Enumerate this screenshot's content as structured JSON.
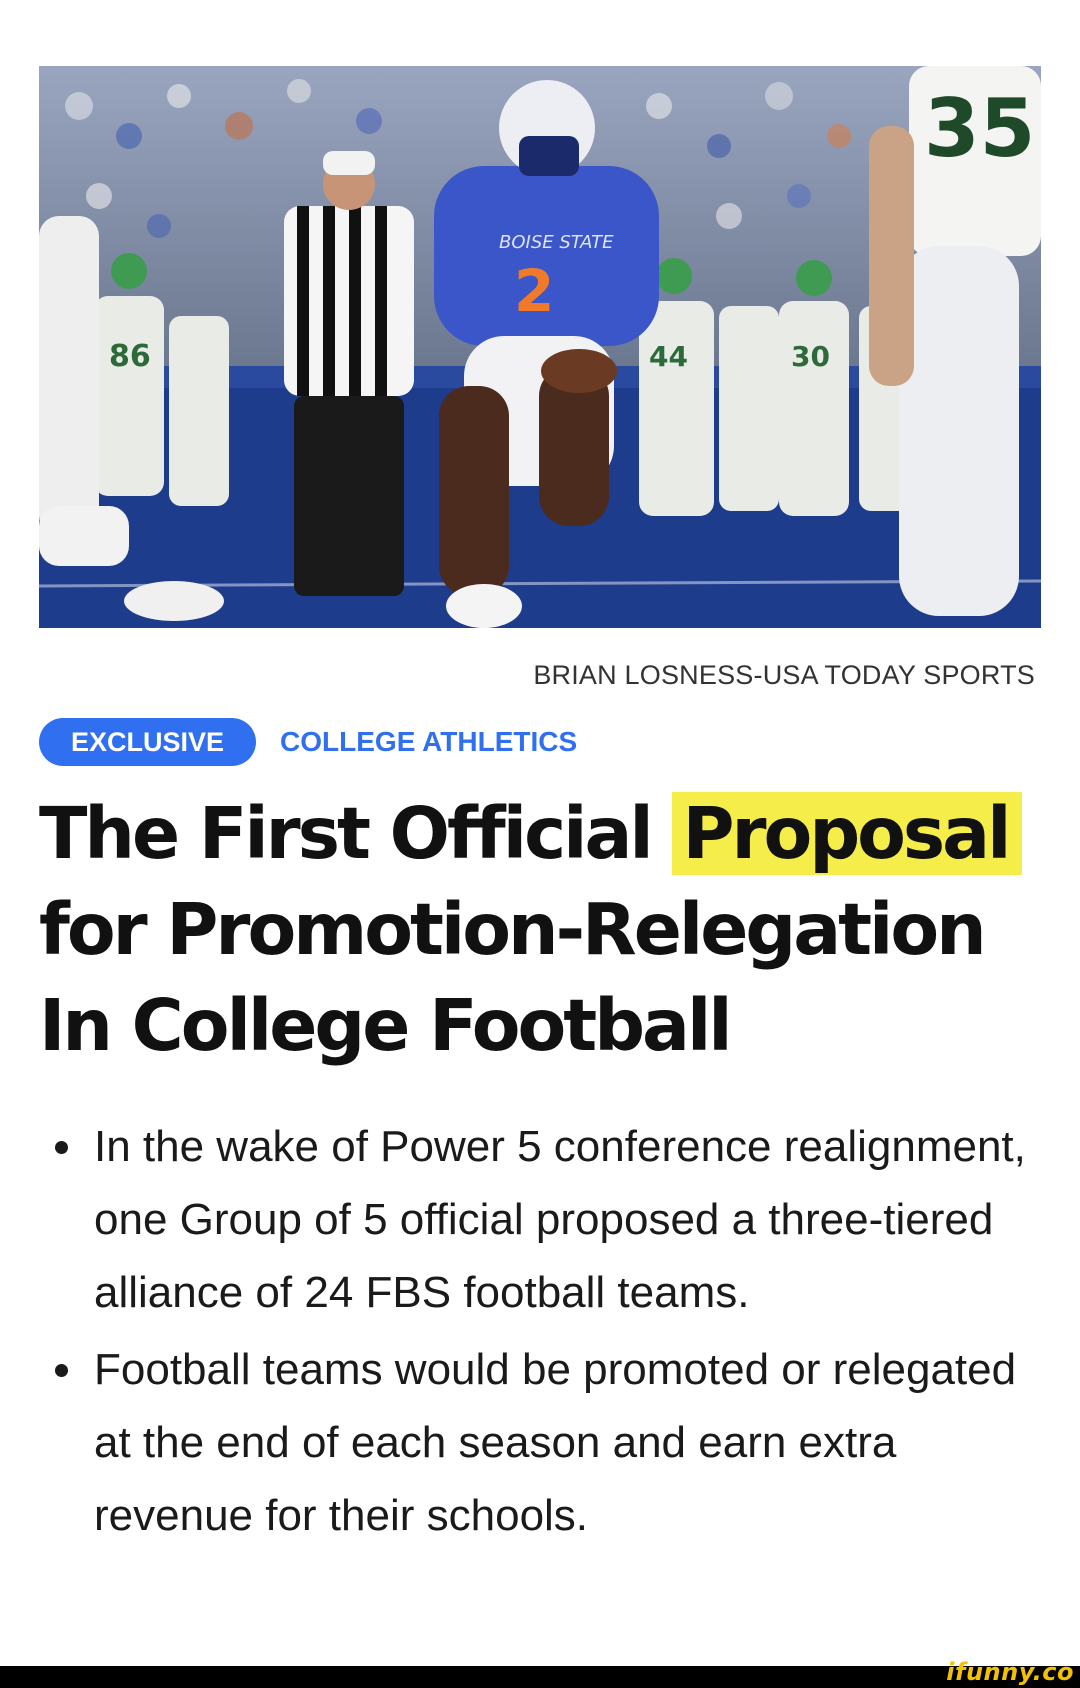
{
  "article": {
    "photo_credit": "BRIAN LOSNESS-USA TODAY SPORTS",
    "badge": "EXCLUSIVE",
    "category": "COLLEGE ATHLETICS",
    "headline_before": "The First Official ",
    "headline_highlight": "Proposal",
    "headline_after": " for Promotion-Relegation In College Football",
    "bullets": [
      "In the wake of Power 5 conference realignment, one Group of 5 official proposed a three-tiered alliance of 24 FBS football teams.",
      "Football teams would be promoted or relegated at the end of each season and earn extra revenue for their schools."
    ]
  },
  "photo_text": {
    "jersey_front": "BOISE STATE",
    "player_number": "2",
    "number_86": "86",
    "number_44": "44",
    "number_30": "30",
    "number_35": "35"
  },
  "watermark": "ifunny.co",
  "colors": {
    "accent": "#2f6ff0",
    "highlight": "#f5ee4a",
    "field": "#1e3c8c",
    "jersey": "#3a56c9"
  }
}
